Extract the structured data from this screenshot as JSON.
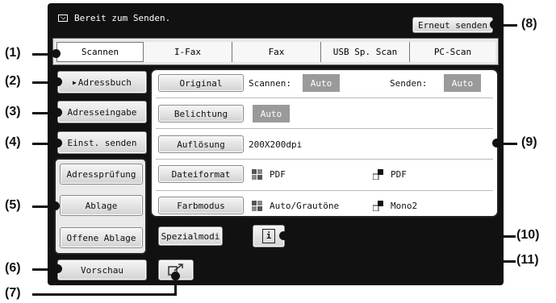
{
  "status": {
    "message": "Bereit zum Senden.",
    "resend_label": "Erneut senden"
  },
  "tabs": [
    "Scannen",
    "I-Fax",
    "Fax",
    "USB Sp. Scan",
    "PC-Scan"
  ],
  "left_buttons": {
    "address_book": "Adressbuch",
    "address_entry": "Adresseingabe",
    "settings_send": "Einst. senden",
    "address_check": "Adressprüfung",
    "filing": "Ablage",
    "quick_file": "Offene Ablage",
    "preview": "Vorschau"
  },
  "settings": {
    "original": {
      "label": "Original",
      "scan_label": "Scannen:",
      "scan_value": "Auto",
      "send_label": "Senden:",
      "send_value": "Auto"
    },
    "exposure": {
      "label": "Belichtung",
      "value": "Auto"
    },
    "resolution": {
      "label": "Auflösung",
      "value": "200X200dpi"
    },
    "file_format": {
      "label": "Dateiformat",
      "color_value": "PDF",
      "mono_value": "PDF"
    },
    "color_mode": {
      "label": "Farbmodus",
      "color_value": "Auto/Grautöne",
      "mono_value": "Mono2"
    }
  },
  "special_modes_label": "Spezialmodi",
  "info_icon_glyph": "i",
  "callouts": {
    "c1": "(1)",
    "c2": "(2)",
    "c3": "(3)",
    "c4": "(4)",
    "c5": "(5)",
    "c6": "(6)",
    "c7": "(7)",
    "c8": "(8)",
    "c9": "(9)",
    "c10": "(10)",
    "c11": "(11)"
  },
  "icons": {
    "status": "envelope-icon",
    "info": "info-icon",
    "send_settings": "send-settings-icon",
    "color_swatch": "color-grid-icon",
    "mono_swatch": "mono-swatch-icon"
  }
}
